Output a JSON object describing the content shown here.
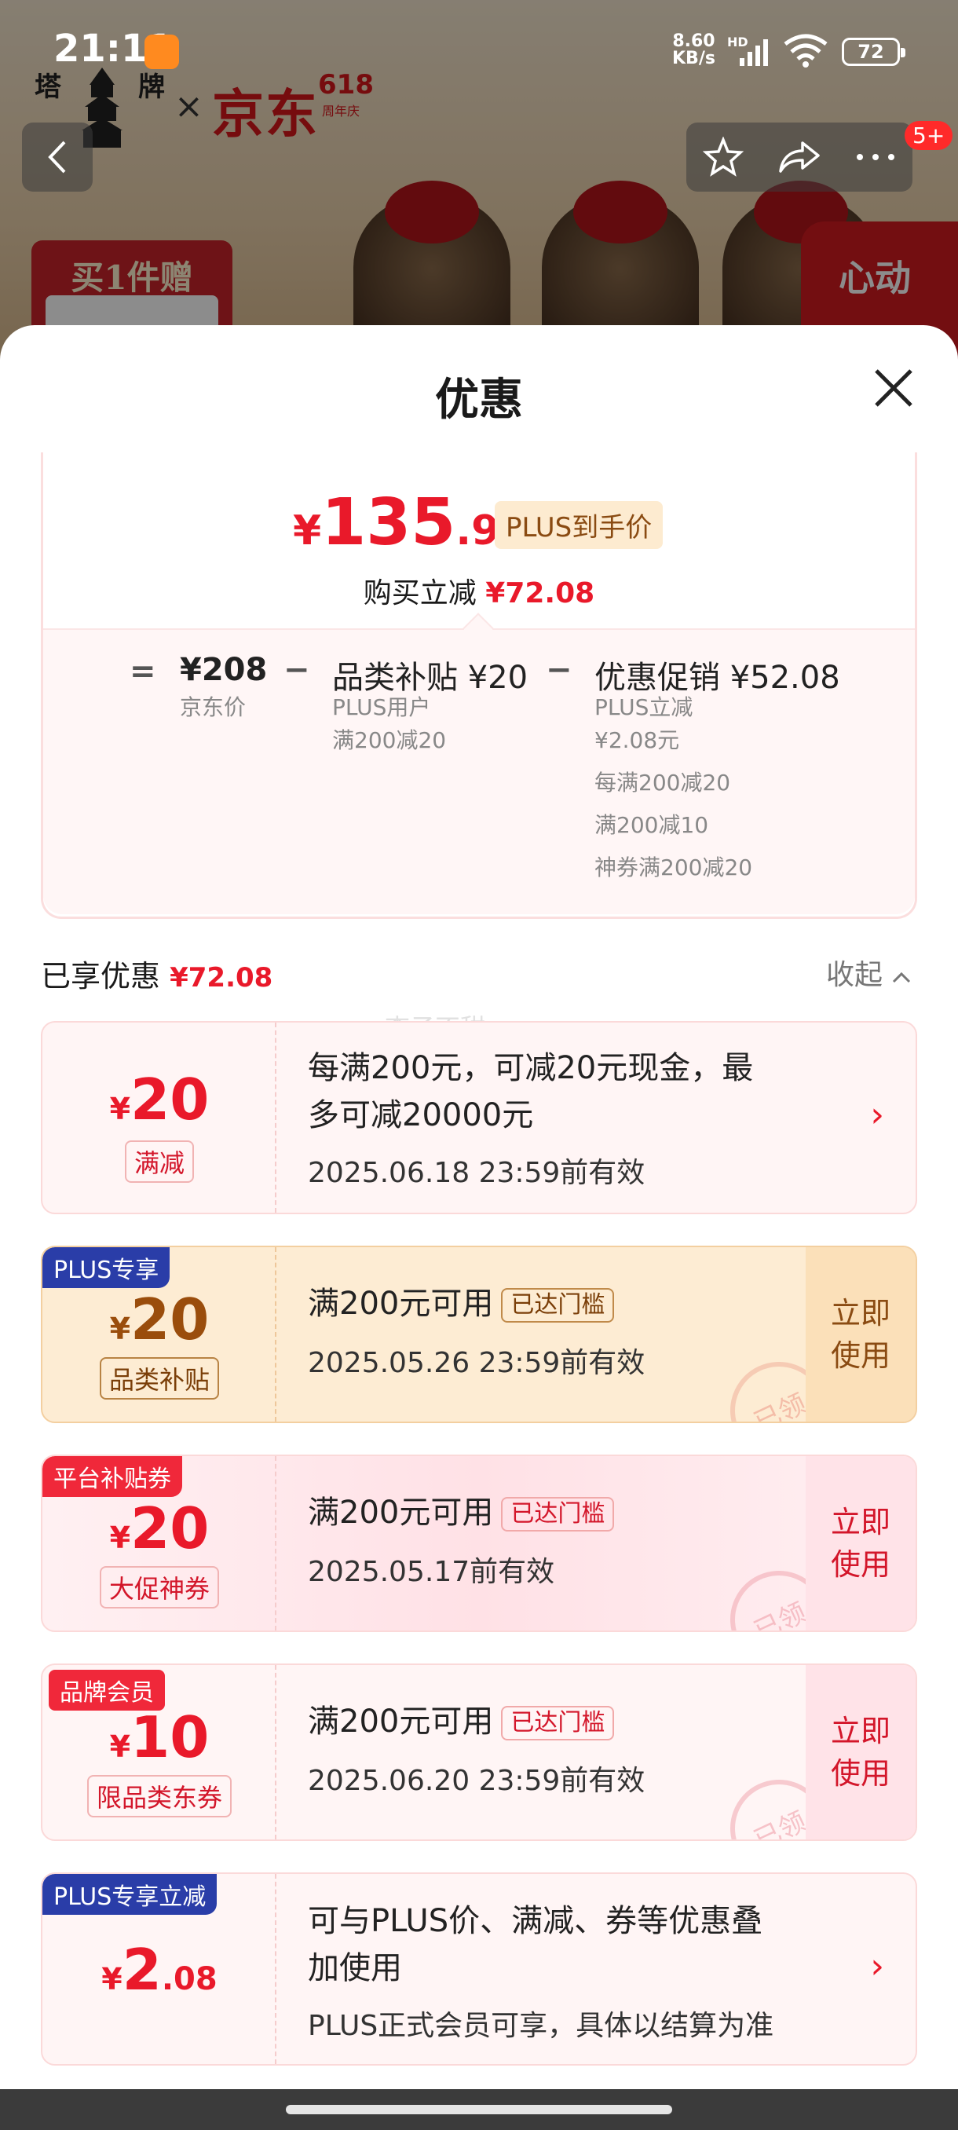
{
  "status_bar": {
    "time": "21:11",
    "net_speed_value": "8.60",
    "net_speed_unit": "KB/s",
    "net_type": "HD",
    "battery": "72"
  },
  "background": {
    "brand_cn": "塔 牌",
    "jd_logo": "京东",
    "jd_618": "618",
    "jd_618_sub": "周年庆",
    "cart_badge": "5+",
    "gift_label": "买1件赠",
    "promo_label": "心动"
  },
  "sheet": {
    "title": "优惠",
    "summary": {
      "yen": "¥",
      "price_int": "135",
      "price_dec": ".92",
      "plus_tag": "PLUS到手价",
      "saved_label": "购买立减",
      "saved_amount": "¥72.08",
      "breakdown": {
        "eq": "=",
        "jd_price": "¥208",
        "jd_price_label": "京东价",
        "minus1": "−",
        "category_title": "品类补贴 ¥20",
        "category_sub1": "PLUS用户",
        "category_sub2": "满200减20",
        "minus2": "−",
        "promo_title": "优惠促销 ¥52.08",
        "promo_sub": [
          "PLUS立减",
          "¥2.08元",
          "每满200减20",
          "满200减10",
          "神券满200减20"
        ]
      }
    },
    "enjoyed": {
      "label": "已享优惠",
      "amount": "¥72.08",
      "collapse": "收起"
    },
    "watermark": "李子不甜",
    "coupons": [
      {
        "yen": "¥",
        "amount": "20",
        "amount_dec": "",
        "kind": "满减",
        "desc_line1": "每满200元，可减20元现金，最",
        "desc_line2": "多可减20000元",
        "valid": "2025.06.18 23:59前有效"
      },
      {
        "corner": "PLUS专享",
        "yen": "¥",
        "amount": "20",
        "amount_dec": "",
        "kind": "品类补贴",
        "desc_line1": "满200元可用",
        "threshold": "已达门槛",
        "valid": "2025.05.26 23:59前有效",
        "use": [
          "立即",
          "使用"
        ],
        "stamp": "已领"
      },
      {
        "corner": "平台补贴券",
        "yen": "¥",
        "amount": "20",
        "amount_dec": "",
        "kind": "大促神券",
        "desc_line1": "满200元可用",
        "threshold": "已达门槛",
        "valid": "2025.05.17前有效",
        "use": [
          "立即",
          "使用"
        ],
        "stamp": "已领"
      },
      {
        "corner": "品牌会员",
        "yen": "¥",
        "amount": "10",
        "amount_dec": "",
        "kind": "限品类东券",
        "desc_line1": "满200元可用",
        "threshold": "已达门槛",
        "valid": "2025.06.20 23:59前有效",
        "use": [
          "立即",
          "使用"
        ],
        "stamp": "已领"
      },
      {
        "corner": "PLUS专享立减",
        "yen": "¥",
        "amount": "2",
        "amount_dec": ".08",
        "desc_line1": "可与PLUS价、满减、券等优惠叠",
        "desc_line2": "加使用",
        "valid": "PLUS正式会员可享，具体以结算为准"
      }
    ]
  },
  "colors": {
    "accent_red": "#e9192a",
    "plus_gold": "#8a4b12",
    "plus_blue": "#2a3da8",
    "coupon_pink": "#fff5f5",
    "coupon_gold": "#fdecd3"
  }
}
